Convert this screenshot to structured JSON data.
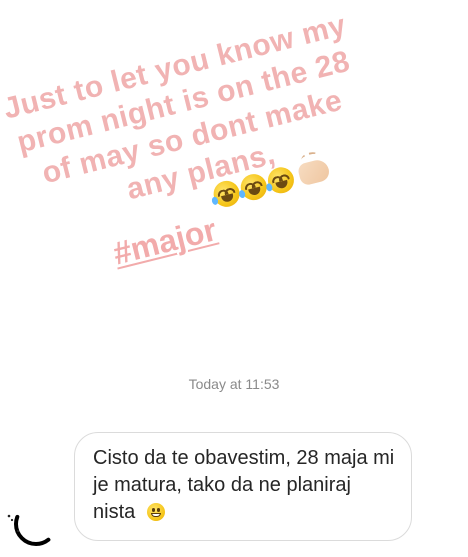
{
  "story": {
    "lines": [
      "Just to let you know my",
      "prom night is on the 28",
      "of may so dont make",
      "any plans,"
    ],
    "hashtag": "#major",
    "emojis": [
      "rolling-on-floor-laughing",
      "rolling-on-floor-laughing",
      "rolling-on-floor-laughing",
      "clapping-hands"
    ],
    "text_color": "#f1b3b3"
  },
  "conversation": {
    "timestamp": "Today at 11:53",
    "message": {
      "text": "Cisto da te obavestim, 28 maja mi je matura, tako da ne planiraj nista",
      "emoji": "grinning-face"
    }
  },
  "avatar": {
    "icon": "avatar-partial"
  }
}
